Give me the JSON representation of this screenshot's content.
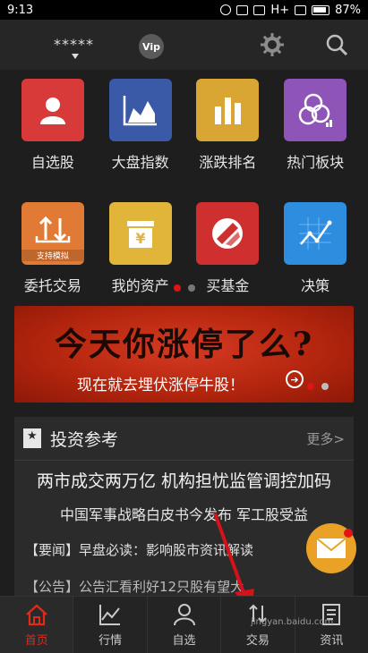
{
  "status": {
    "time": "9:13",
    "network": "H+",
    "battery": "87%"
  },
  "header": {
    "account_masked": "*****",
    "vip_label": "Vip"
  },
  "grid": [
    {
      "label": "自选股",
      "color": "#d83a3a",
      "icon": "user-icon"
    },
    {
      "label": "大盘指数",
      "color": "#3a5aa8",
      "icon": "area-chart-icon"
    },
    {
      "label": "涨跌排名",
      "color": "#d9a634",
      "icon": "bar-chart-icon"
    },
    {
      "label": "热门板块",
      "color": "#8f54b8",
      "icon": "bubbles-icon"
    },
    {
      "label": "委托交易",
      "color": "#e07a35",
      "icon": "trade-icon",
      "badge": "支持模拟"
    },
    {
      "label": "我的资产",
      "color": "#e0b53a",
      "icon": "yen-icon"
    },
    {
      "label": "买基金",
      "color": "#cf2f2f",
      "icon": "fund-icon"
    },
    {
      "label": "决策",
      "color": "#2f8de0",
      "icon": "decision-chart-icon"
    }
  ],
  "banner": {
    "headline": "今天你涨停了么?",
    "subline": "现在就去埋伏涨停牛股！"
  },
  "news": {
    "title": "投资参考",
    "more": "更多>",
    "headline_1": "两市成交两万亿 机构担忧监管调控加码",
    "headline_2": "中国军事战略白皮书今发布 军工股受益",
    "item_1": "【要闻】早盘必读：影响股市资讯解读",
    "item_2": "【公告】公告汇看利好12只股有望大"
  },
  "bottom_nav": [
    {
      "label": "首页",
      "icon": "home-icon",
      "active": true
    },
    {
      "label": "行情",
      "icon": "chart-icon",
      "active": false
    },
    {
      "label": "自选",
      "icon": "person-icon",
      "active": false
    },
    {
      "label": "交易",
      "icon": "trade-icon",
      "active": false
    },
    {
      "label": "资讯",
      "icon": "news-icon",
      "active": false
    }
  ],
  "watermark": "jingyan.baidu.com"
}
